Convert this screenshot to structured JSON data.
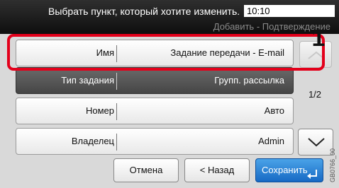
{
  "header": {
    "message": "Выбрать пункт, который хотите изменить.",
    "time": "10:10",
    "subtitle": "Добавить - Подтверждение"
  },
  "rows": [
    {
      "label": "Имя",
      "value": "Задание передачи - E-mail"
    },
    {
      "label": "Тип задания",
      "value": "Групп. рассылка"
    },
    {
      "label": "Номер",
      "value": "Авто"
    },
    {
      "label": "Владелец",
      "value": "Admin"
    }
  ],
  "pager": {
    "page": "1/2"
  },
  "buttons": {
    "cancel": "Отмена",
    "back": "< Назад",
    "save": "Сохранить"
  },
  "callout": "1",
  "figure_code": "GB0766_00",
  "colors": {
    "highlight": "#e3001b",
    "save_button": "#1f74cc"
  },
  "icons": {
    "scroll_up": "chevron-up-icon",
    "scroll_down": "chevron-down-icon",
    "save_enter": "enter-icon"
  }
}
